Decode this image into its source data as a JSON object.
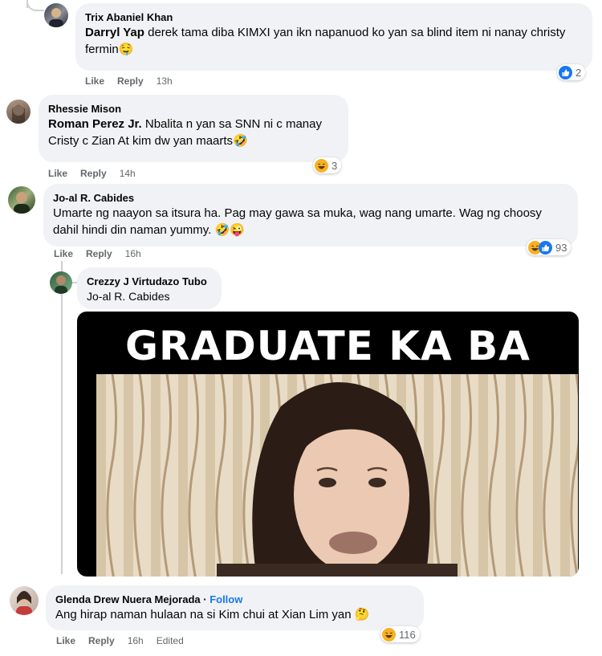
{
  "comments": [
    {
      "author": "Trix Abaniel Khan",
      "mention": "Darryl Yap",
      "text": " derek tama diba KIMXI yan ikn napanuod ko yan sa blind item ni nanay christy fermin🤤",
      "like": "Like",
      "reply": "Reply",
      "time": "13h",
      "reactions": {
        "count": "2",
        "icons": [
          "like"
        ]
      }
    },
    {
      "author": "Rhessie Mison",
      "mention": "Roman Perez Jr.",
      "text": " Nbalita n yan sa SNN ni c manay Cristy c Zian At kim dw yan maarts🤣",
      "like": "Like",
      "reply": "Reply",
      "time": "14h",
      "reactions": {
        "count": "3",
        "icons": [
          "haha"
        ]
      }
    },
    {
      "author": "Jo-al R. Cabides",
      "text": "Umarte ng naayon sa itsura ha. Pag may gawa sa muka, wag nang umarte. Wag ng choosy dahil hindi din naman yummy. 🤣😜",
      "like": "Like",
      "reply": "Reply",
      "time": "16h",
      "reactions": {
        "count": "93",
        "icons": [
          "haha",
          "like"
        ]
      }
    },
    {
      "author": "Crezzy J Virtudazo Tubo",
      "mention": "Jo-al R. Cabides",
      "gif_caption": "GRADUATE KA BA"
    },
    {
      "author": "Glenda Drew Nuera Mejorada",
      "follow": "Follow",
      "text": "Ang hirap naman hulaan na si Kim chui at Xian Lim yan 🤔",
      "like": "Like",
      "reply": "Reply",
      "time": "16h",
      "edited": "Edited",
      "reactions": {
        "count": "116",
        "icons": [
          "haha"
        ]
      }
    }
  ],
  "colors": {
    "like_blue": "#1877f2",
    "haha_yellow": "#f7b125",
    "bubble": "#f0f2f5"
  }
}
